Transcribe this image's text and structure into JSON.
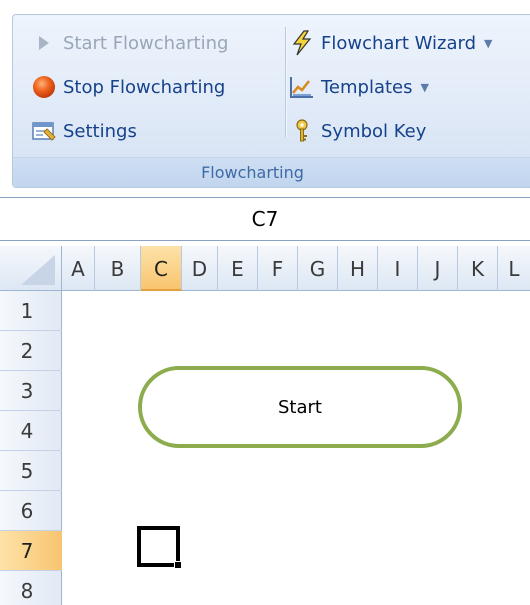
{
  "ribbon": {
    "commands": {
      "start": {
        "label": "Start Flowcharting",
        "icon": "play-triangle-icon"
      },
      "stop": {
        "label": "Stop Flowcharting",
        "icon": "red-circle-icon"
      },
      "settings": {
        "label": "Settings",
        "icon": "settings-window-icon"
      },
      "wizard": {
        "label": "Flowchart Wizard",
        "icon": "lightning-icon"
      },
      "templates": {
        "label": "Templates",
        "icon": "templates-chart-icon"
      },
      "symbol_key": {
        "label": "Symbol Key",
        "icon": "key-icon"
      }
    },
    "group_label": "Flowcharting"
  },
  "name_box": {
    "value": "C7"
  },
  "columns": [
    "A",
    "B",
    "C",
    "D",
    "E",
    "F",
    "G",
    "H",
    "I",
    "J",
    "K",
    "L"
  ],
  "active_column": "C",
  "rows": [
    "1",
    "2",
    "3",
    "4",
    "5",
    "6",
    "7",
    "8"
  ],
  "active_row": "7",
  "shapes": {
    "start_terminator": {
      "text": "Start"
    }
  },
  "colors": {
    "accent_blue": "#15428b",
    "terminator_border": "#8cac4d",
    "active_header": "#f9c470"
  }
}
